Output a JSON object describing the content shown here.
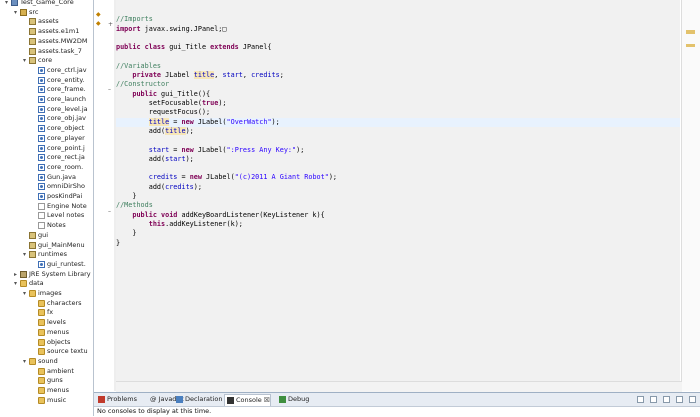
{
  "tree": [
    {
      "label": "Test_Game_Core",
      "depth": 0,
      "twisty": "▾",
      "icon": "project"
    },
    {
      "label": "src",
      "depth": 1,
      "twisty": "▾",
      "icon": "src"
    },
    {
      "label": "assets",
      "depth": 2,
      "twisty": "",
      "icon": "pkg"
    },
    {
      "label": "assets.e1m1",
      "depth": 2,
      "twisty": "",
      "icon": "pkg"
    },
    {
      "label": "assets.MW2DM",
      "depth": 2,
      "twisty": "",
      "icon": "pkg"
    },
    {
      "label": "assets.task_7",
      "depth": 2,
      "twisty": "",
      "icon": "pkg"
    },
    {
      "label": "core",
      "depth": 2,
      "twisty": "▾",
      "icon": "pkg"
    },
    {
      "label": "core_ctrl.jav",
      "depth": 3,
      "twisty": "",
      "icon": "java"
    },
    {
      "label": "core_entity.",
      "depth": 3,
      "twisty": "",
      "icon": "java"
    },
    {
      "label": "core_frame.",
      "depth": 3,
      "twisty": "",
      "icon": "java"
    },
    {
      "label": "core_launch",
      "depth": 3,
      "twisty": "",
      "icon": "java"
    },
    {
      "label": "core_level.ja",
      "depth": 3,
      "twisty": "",
      "icon": "java"
    },
    {
      "label": "core_obj.jav",
      "depth": 3,
      "twisty": "",
      "icon": "java"
    },
    {
      "label": "core_object",
      "depth": 3,
      "twisty": "",
      "icon": "java"
    },
    {
      "label": "core_player",
      "depth": 3,
      "twisty": "",
      "icon": "java"
    },
    {
      "label": "core_point.j",
      "depth": 3,
      "twisty": "",
      "icon": "java"
    },
    {
      "label": "core_rect.ja",
      "depth": 3,
      "twisty": "",
      "icon": "java"
    },
    {
      "label": "core_room.",
      "depth": 3,
      "twisty": "",
      "icon": "java"
    },
    {
      "label": "Gun.java",
      "depth": 3,
      "twisty": "",
      "icon": "java"
    },
    {
      "label": "omniDirSho",
      "depth": 3,
      "twisty": "",
      "icon": "java"
    },
    {
      "label": "posKindPai",
      "depth": 3,
      "twisty": "",
      "icon": "java"
    },
    {
      "label": "Engine Note",
      "depth": 3,
      "twisty": "",
      "icon": "file"
    },
    {
      "label": "Level notes",
      "depth": 3,
      "twisty": "",
      "icon": "file"
    },
    {
      "label": "Notes",
      "depth": 3,
      "twisty": "",
      "icon": "file"
    },
    {
      "label": "gui",
      "depth": 2,
      "twisty": "",
      "icon": "pkg"
    },
    {
      "label": "gui_MainMenu",
      "depth": 2,
      "twisty": "",
      "icon": "pkg"
    },
    {
      "label": "runtimes",
      "depth": 2,
      "twisty": "▾",
      "icon": "pkg"
    },
    {
      "label": "gui_runtest.",
      "depth": 3,
      "twisty": "",
      "icon": "java"
    },
    {
      "label": "JRE System Library",
      "depth": 1,
      "twisty": "▸",
      "icon": "lib"
    },
    {
      "label": "data",
      "depth": 1,
      "twisty": "▾",
      "icon": "folder"
    },
    {
      "label": "images",
      "depth": 2,
      "twisty": "▾",
      "icon": "folder"
    },
    {
      "label": "characters",
      "depth": 3,
      "twisty": "",
      "icon": "folder"
    },
    {
      "label": "fx",
      "depth": 3,
      "twisty": "",
      "icon": "folder"
    },
    {
      "label": "levels",
      "depth": 3,
      "twisty": "",
      "icon": "folder"
    },
    {
      "label": "menus",
      "depth": 3,
      "twisty": "",
      "icon": "folder"
    },
    {
      "label": "objects",
      "depth": 3,
      "twisty": "",
      "icon": "folder"
    },
    {
      "label": "source textu",
      "depth": 3,
      "twisty": "",
      "icon": "folder"
    },
    {
      "label": "sound",
      "depth": 2,
      "twisty": "▾",
      "icon": "folder"
    },
    {
      "label": "ambient",
      "depth": 3,
      "twisty": "",
      "icon": "folder"
    },
    {
      "label": "guns",
      "depth": 3,
      "twisty": "",
      "icon": "folder"
    },
    {
      "label": "menus",
      "depth": 3,
      "twisty": "",
      "icon": "folder"
    },
    {
      "label": "music",
      "depth": 3,
      "twisty": "",
      "icon": "folder"
    }
  ],
  "editor": {
    "lines": [
      [],
      [
        {
          "t": "//Imports",
          "c": "cm"
        }
      ],
      [
        {
          "t": "import",
          "c": "kw"
        },
        {
          "t": " javax.swing.JPanel;",
          "c": ""
        },
        {
          "t": "□",
          "c": ""
        }
      ],
      [],
      [
        {
          "t": "public class",
          "c": "kw"
        },
        {
          "t": " gui_Title ",
          "c": ""
        },
        {
          "t": "extends",
          "c": "kw"
        },
        {
          "t": " JPanel{",
          "c": ""
        }
      ],
      [],
      [
        {
          "t": "//Variables",
          "c": "cm"
        }
      ],
      [
        {
          "t": "    ",
          "c": ""
        },
        {
          "t": "private",
          "c": "kw"
        },
        {
          "t": " JLabel ",
          "c": ""
        },
        {
          "t": "title",
          "c": "fd ref"
        },
        {
          "t": ", ",
          "c": ""
        },
        {
          "t": "start",
          "c": "fd"
        },
        {
          "t": ", ",
          "c": ""
        },
        {
          "t": "credits",
          "c": "fd"
        },
        {
          "t": ";",
          "c": ""
        }
      ],
      [
        {
          "t": "//Constructor",
          "c": "cm"
        }
      ],
      [
        {
          "t": "    ",
          "c": ""
        },
        {
          "t": "public",
          "c": "kw"
        },
        {
          "t": " gui_Title(){",
          "c": ""
        }
      ],
      [
        {
          "t": "        setFocusable(",
          "c": ""
        },
        {
          "t": "true",
          "c": "kw"
        },
        {
          "t": ");",
          "c": ""
        }
      ],
      [
        {
          "t": "        requestFocus();",
          "c": ""
        }
      ],
      [
        {
          "t": "        ",
          "c": ""
        },
        {
          "t": "title",
          "c": "fd ref"
        },
        {
          "t": " = ",
          "c": ""
        },
        {
          "t": "new",
          "c": "kw"
        },
        {
          "t": " JLabel(",
          "c": ""
        },
        {
          "t": "\"OverWatch\"",
          "c": "st"
        },
        {
          "t": ");",
          "c": ""
        }
      ],
      [
        {
          "t": "        add(",
          "c": ""
        },
        {
          "t": "title",
          "c": "fd ref"
        },
        {
          "t": ");",
          "c": ""
        }
      ],
      [],
      [
        {
          "t": "        ",
          "c": ""
        },
        {
          "t": "start",
          "c": "fd"
        },
        {
          "t": " = ",
          "c": ""
        },
        {
          "t": "new",
          "c": "kw"
        },
        {
          "t": " JLabel(",
          "c": ""
        },
        {
          "t": "\":Press Any Key:\"",
          "c": "st"
        },
        {
          "t": ");",
          "c": ""
        }
      ],
      [
        {
          "t": "        add(",
          "c": ""
        },
        {
          "t": "start",
          "c": "fd"
        },
        {
          "t": ");",
          "c": ""
        }
      ],
      [],
      [
        {
          "t": "        ",
          "c": ""
        },
        {
          "t": "credits",
          "c": "fd"
        },
        {
          "t": " = ",
          "c": ""
        },
        {
          "t": "new",
          "c": "kw"
        },
        {
          "t": " JLabel(",
          "c": ""
        },
        {
          "t": "\"(c)2011 A Giant Robot\"",
          "c": "st"
        },
        {
          "t": ");",
          "c": ""
        }
      ],
      [
        {
          "t": "        add(",
          "c": ""
        },
        {
          "t": "credits",
          "c": "fd"
        },
        {
          "t": ");",
          "c": ""
        }
      ],
      [
        {
          "t": "    }",
          "c": ""
        }
      ],
      [
        {
          "t": "//Methods",
          "c": "cm"
        }
      ],
      [
        {
          "t": "    ",
          "c": ""
        },
        {
          "t": "public void",
          "c": "kw"
        },
        {
          "t": " addKeyBoardListener(KeyListener k){",
          "c": ""
        }
      ],
      [
        {
          "t": "        ",
          "c": ""
        },
        {
          "t": "this",
          "c": "kw"
        },
        {
          "t": ".addKeyListener(k);",
          "c": ""
        }
      ],
      [
        {
          "t": "    }",
          "c": ""
        }
      ],
      [
        {
          "t": "}",
          "c": ""
        }
      ]
    ]
  },
  "panel": {
    "tabs": [
      {
        "label": "Problems",
        "icon": "problems-icon",
        "color": "#c0392b"
      },
      {
        "label": "@ Javadoc",
        "icon": "javadoc-icon",
        "color": ""
      },
      {
        "label": "Declaration",
        "icon": "declaration-icon",
        "color": "#4a7fbf"
      },
      {
        "label": "Console ☒",
        "icon": "console-icon",
        "color": "#333333",
        "active": true
      },
      {
        "label": "Debug",
        "icon": "debug-icon",
        "color": "#3f8f3f"
      }
    ],
    "status": "No consoles to display at this time."
  }
}
